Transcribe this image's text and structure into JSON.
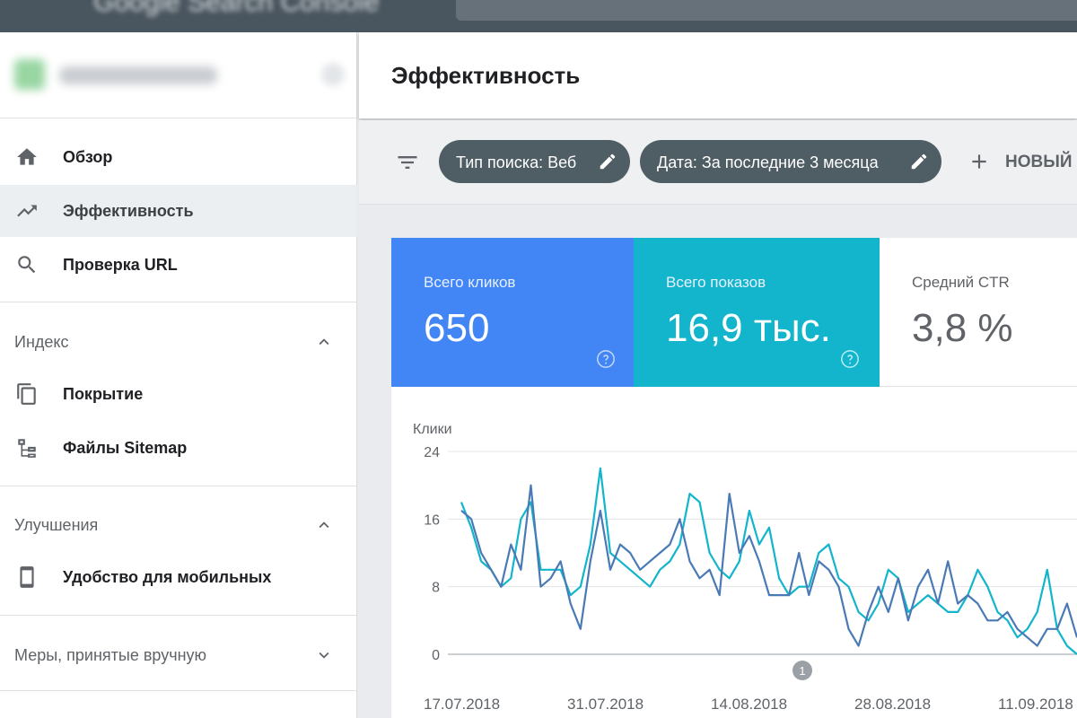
{
  "app": {
    "title": "Google Search Console",
    "search_placeholder": ""
  },
  "sidebar": {
    "nav": [
      {
        "label": "Обзор",
        "icon": "home-icon"
      },
      {
        "label": "Эффективность",
        "icon": "trending-up-icon"
      },
      {
        "label": "Проверка URL",
        "icon": "search-icon"
      }
    ],
    "sections": [
      {
        "label": "Индекс",
        "expanded": true,
        "items": [
          {
            "label": "Покрытие",
            "icon": "copy-pages-icon"
          },
          {
            "label": "Файлы Sitemap",
            "icon": "sitemap-icon"
          }
        ]
      },
      {
        "label": "Улучшения",
        "expanded": true,
        "items": [
          {
            "label": "Удобство для мобильных",
            "icon": "smartphone-icon"
          }
        ]
      },
      {
        "label": "Меры, принятые вручную",
        "expanded": false,
        "items": []
      }
    ]
  },
  "main": {
    "title": "Эффективность",
    "filters": [
      {
        "label": "Тип поиска: Веб"
      },
      {
        "label": "Дата: За последние 3 месяца"
      }
    ],
    "new_label": "НОВЫЙ"
  },
  "metrics": [
    {
      "label": "Всего кликов",
      "value": "650",
      "color": "#4285f4",
      "selected": true
    },
    {
      "label": "Всего показов",
      "value": "16,9 тыс.",
      "color": "#12b5cb",
      "selected": true
    },
    {
      "label": "Средний CTR",
      "value": "3,8 %",
      "color": "#ffffff",
      "selected": false
    }
  ],
  "chart_data": {
    "type": "line",
    "ylabel": "Клики",
    "ylim": [
      0,
      24
    ],
    "yticks": [
      "24",
      "16",
      "8",
      "0"
    ],
    "grid": true,
    "x_tick_labels": [
      "17.07.2018",
      "31.07.2018",
      "14.08.2018",
      "28.08.2018",
      "11.09.2018"
    ],
    "annotations": [
      {
        "text": "1"
      }
    ],
    "series": [
      {
        "color": "#12b5cb",
        "values": [
          18,
          15,
          11,
          10,
          8,
          9,
          16,
          18,
          10,
          10,
          10,
          7,
          8,
          13,
          22,
          12,
          11,
          10,
          9,
          8,
          10,
          11,
          13,
          19,
          18,
          12,
          10,
          9,
          11,
          17,
          13,
          15,
          9,
          7,
          8,
          8,
          12,
          13,
          9,
          8,
          5,
          4,
          6,
          10,
          9,
          5,
          6,
          7,
          6,
          5,
          5,
          7,
          10,
          8,
          5,
          4,
          2,
          3,
          5,
          10,
          3,
          1,
          0
        ]
      },
      {
        "color": "#4a7ab5",
        "values": [
          17,
          16,
          12,
          10,
          8,
          13,
          10,
          20,
          8,
          9,
          11,
          6,
          3,
          11,
          17,
          10,
          13,
          12,
          10,
          11,
          12,
          13,
          16,
          11,
          9,
          10,
          7,
          19,
          12,
          14,
          11,
          7,
          7,
          7,
          12,
          7,
          11,
          10,
          8,
          3,
          1,
          5,
          8,
          5,
          9,
          4,
          8,
          10,
          6,
          11,
          6,
          7,
          6,
          4,
          4,
          5,
          3,
          2,
          1,
          3,
          3,
          6,
          2
        ]
      }
    ]
  }
}
